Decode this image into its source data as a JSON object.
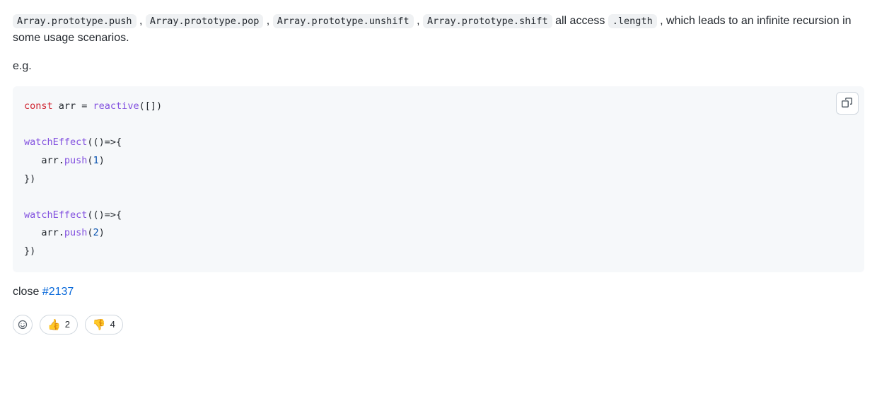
{
  "paragraph": {
    "codes": [
      "Array.prototype.push",
      "Array.prototype.pop",
      "Array.prototype.unshift",
      "Array.prototype.shift"
    ],
    "sep": " , ",
    "mid_text": " all access ",
    "length_code": ".length",
    "tail_text": " , which leads to an infinite recursion in some usage scenarios."
  },
  "eg_label": "e.g.",
  "codeblock": {
    "l1_kw": "const",
    "l1_rest_a": " arr = ",
    "l1_fn": "reactive",
    "l1_rest_b": "([])",
    "l3_fn": "watchEffect",
    "l3_rest": "(()=>{",
    "l4_pre": "   arr.",
    "l4_fn": "push",
    "l4_arg_open": "(",
    "l4_num": "1",
    "l4_arg_close": ")",
    "l5": "})",
    "l7_fn": "watchEffect",
    "l7_rest": "(()=>{",
    "l8_pre": "   arr.",
    "l8_fn": "push",
    "l8_arg_open": "(",
    "l8_num": "2",
    "l8_arg_close": ")",
    "l9": "})"
  },
  "close_text": "close ",
  "close_link": "#2137",
  "reactions": {
    "thumbs_up_emoji": "👍",
    "thumbs_up_count": "2",
    "thumbs_down_emoji": "👎",
    "thumbs_down_count": "4"
  }
}
